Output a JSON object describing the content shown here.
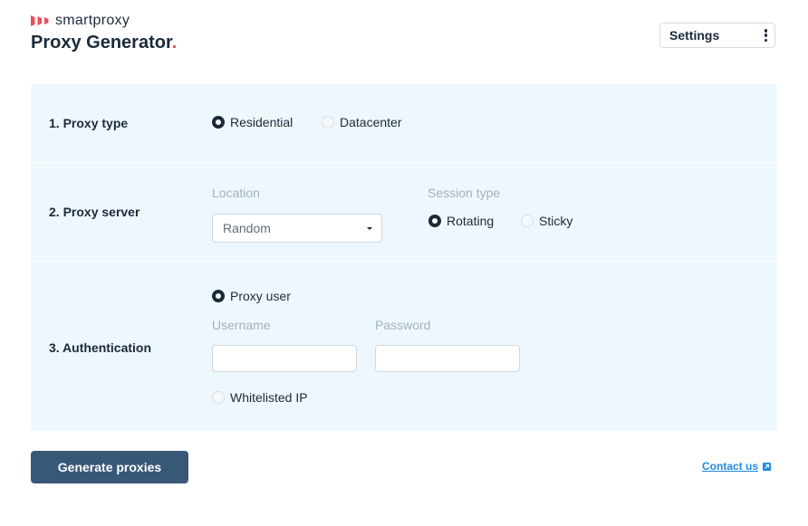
{
  "brand": {
    "name": "smartproxy",
    "accent_color": "#e8505b"
  },
  "header": {
    "title": "Proxy Generator",
    "title_dot": ".",
    "settings_label": "Settings"
  },
  "sections": {
    "proxy_type": {
      "label": "1. Proxy type",
      "options": [
        {
          "label": "Residential",
          "selected": true
        },
        {
          "label": "Datacenter",
          "selected": false
        }
      ]
    },
    "proxy_server": {
      "label": "2. Proxy server",
      "location_label": "Location",
      "location_value": "Random",
      "session_label": "Session type",
      "session_options": [
        {
          "label": "Rotating",
          "selected": true
        },
        {
          "label": "Sticky",
          "selected": false
        }
      ]
    },
    "authentication": {
      "label": "3. Authentication",
      "proxy_user_label": "Proxy user",
      "username_label": "Username",
      "username_value": "",
      "password_label": "Password",
      "password_value": "",
      "whitelisted_label": "Whitelisted IP",
      "proxy_user_selected": true,
      "whitelisted_selected": false
    }
  },
  "footer": {
    "generate_label": "Generate proxies",
    "contact_label": "Contact us"
  },
  "colors": {
    "primary_button": "#385878",
    "panel_bg": "#eef7fd",
    "link": "#1f8be0",
    "text": "#1b2a3a",
    "muted_label": "#a3b2be"
  },
  "icons": {
    "brand_logo": "brand-logo-icon",
    "settings_menu": "kebab-menu-icon",
    "dropdown": "chevron-down-icon",
    "contact": "external-link-icon"
  }
}
